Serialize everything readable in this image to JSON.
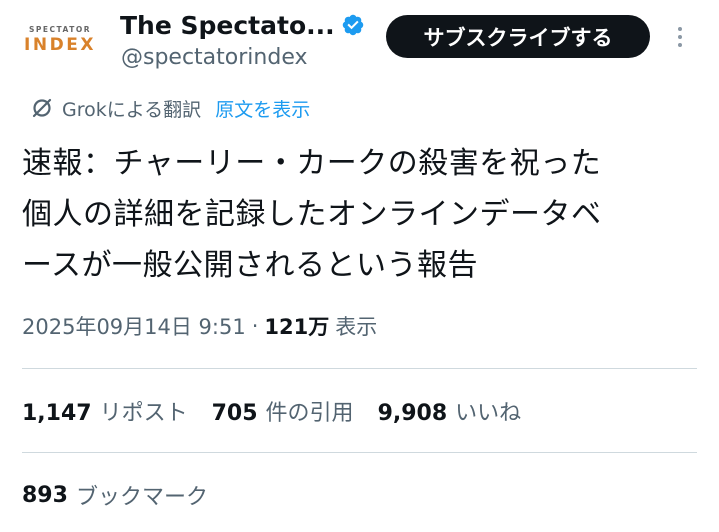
{
  "account": {
    "avatar_top": "SPECTATOR",
    "avatar_bottom": "INDEX",
    "display_name": "The Spectato...",
    "handle": "@spectatorindex",
    "subscribe_label": "サブスクライブする",
    "verified_color": "#1d9bf0"
  },
  "translation": {
    "icon": "grok-icon",
    "translated_by": "Grokによる翻訳",
    "show_original": "原文を表示"
  },
  "tweet": {
    "lines": [
      "速報：チャーリー・カークの殺害を祝った",
      "個人の詳細を記録したオンラインデータベ",
      "ースが一般公開されるという報告"
    ]
  },
  "meta": {
    "timestamp": "2025年09月14日 9:51",
    "separator": "·",
    "views_count": "121万",
    "views_label": "表示"
  },
  "stats": {
    "reposts_count": "1,147",
    "reposts_label": "リポスト",
    "quotes_count": "705",
    "quotes_label": "件の引用",
    "likes_count": "9,908",
    "likes_label": "いいね",
    "bookmarks_count": "893",
    "bookmarks_label": "ブックマーク"
  },
  "colors": {
    "text_primary": "#0f1419",
    "text_secondary": "#536471",
    "link": "#1d9bf0",
    "button_bg": "#0f1419",
    "divider": "#cfd9de"
  }
}
